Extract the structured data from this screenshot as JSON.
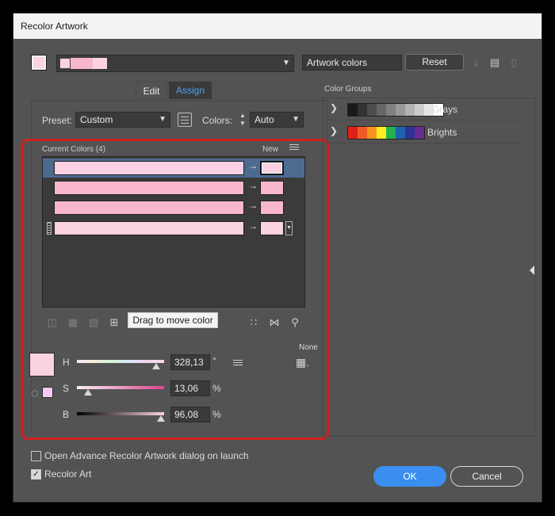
{
  "window": {
    "title": "Recolor Artwork"
  },
  "toolbar": {
    "color_strip_segments": [
      "#fbd2e1",
      "#f8b7cc",
      "#f8b7cc",
      "#fbd2e1"
    ],
    "artwork_name": "Artwork colors",
    "reset_label": "Reset"
  },
  "tabs": {
    "edit": "Edit",
    "assign": "Assign"
  },
  "preset": {
    "label": "Preset:",
    "value": "Custom"
  },
  "colors": {
    "label": "Colors:",
    "value": "Auto"
  },
  "current_colors": {
    "header": "Current Colors (4)",
    "new_header": "New",
    "rows": [
      {
        "current": "#fbd2e1",
        "new": "#fbd2e1",
        "selected": true
      },
      {
        "current": "#f8b7cc",
        "new": "#f8b7cc",
        "selected": false
      },
      {
        "current": "#f8b7cc",
        "new": "#f8b7cc",
        "selected": false
      },
      {
        "current": "#fbd2e1",
        "new": "#fbd2e1",
        "selected": false
      }
    ]
  },
  "tooltip": "Drag to move color",
  "hsb": {
    "swatch_color": "#fbd2e1",
    "none_label": "None",
    "h": {
      "label": "H",
      "value": "328,13",
      "unit": "°",
      "fraction": 0.91
    },
    "s": {
      "label": "S",
      "value": "13,06",
      "unit": "%",
      "fraction": 0.13
    },
    "b": {
      "label": "B",
      "value": "96,08",
      "unit": "%",
      "fraction": 0.96
    }
  },
  "color_groups": {
    "header": "Color Groups",
    "groups": [
      {
        "name": "Grays",
        "swatches": [
          "#1a1a1a",
          "#333333",
          "#4d4d4d",
          "#666666",
          "#808080",
          "#999999",
          "#b3b3b3",
          "#cccccc",
          "#e6e6e6",
          "#ffffff"
        ]
      },
      {
        "name": "Brights",
        "swatches": [
          "#e0201b",
          "#f15a24",
          "#f7931e",
          "#fcee21",
          "#22b14c",
          "#1e63b0",
          "#2e3192",
          "#662d91"
        ]
      }
    ]
  },
  "footer": {
    "open_advance_label": "Open Advance Recolor Artwork dialog on launch",
    "open_advance_checked": false,
    "recolor_art_label": "Recolor Art",
    "recolor_art_checked": true,
    "ok_label": "OK",
    "cancel_label": "Cancel"
  }
}
